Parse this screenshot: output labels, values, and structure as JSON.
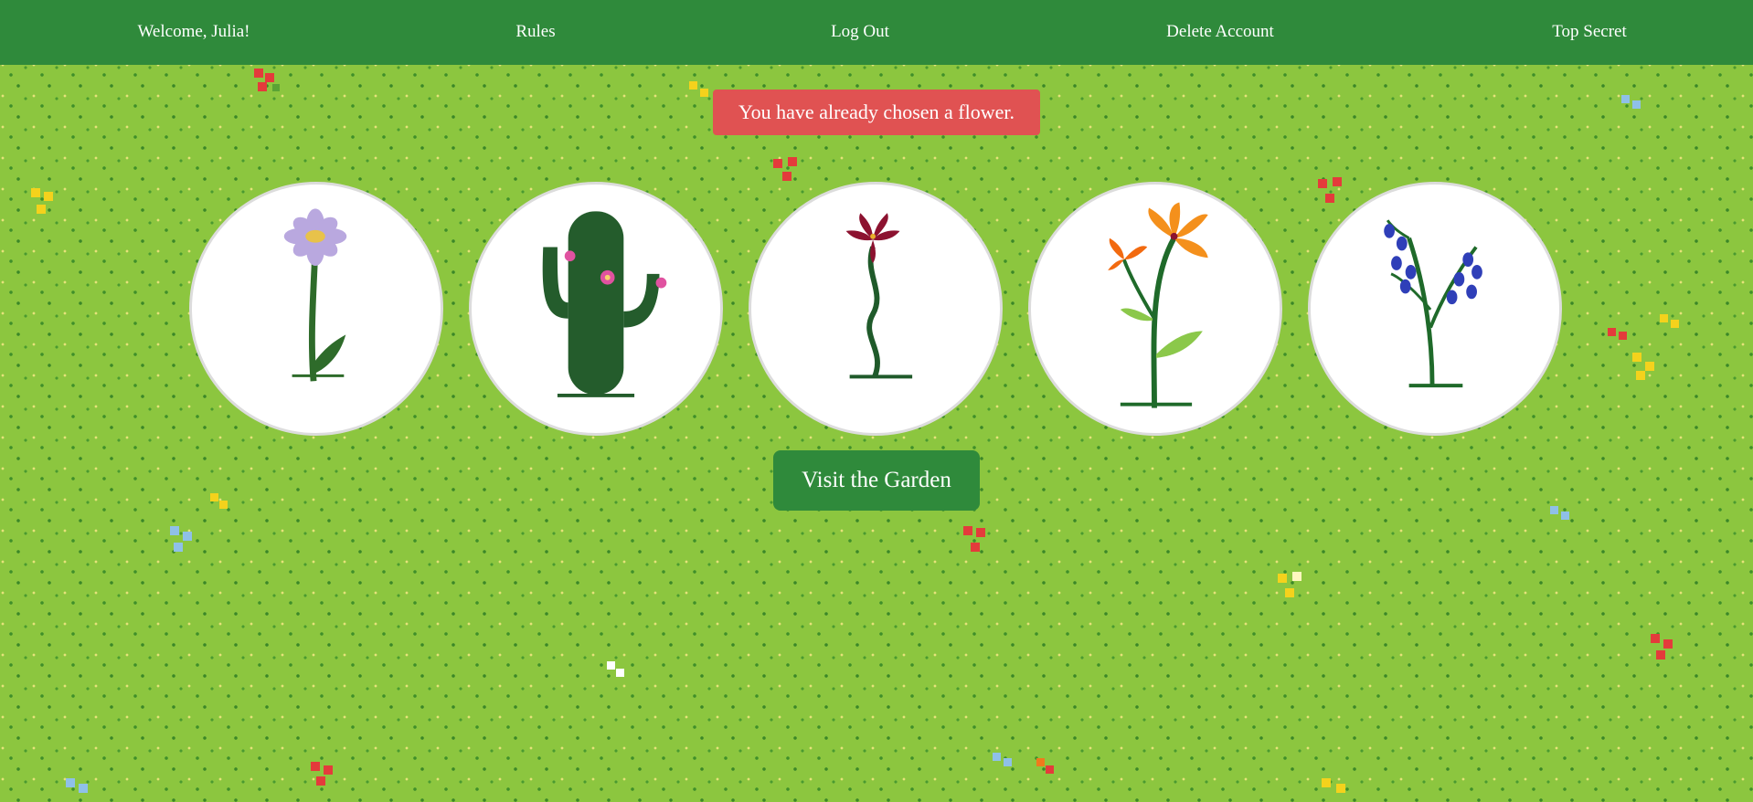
{
  "nav": {
    "welcome": "Welcome, Julia!",
    "rules": "Rules",
    "logout": "Log Out",
    "delete_account": "Delete Account",
    "top_secret": "Top Secret"
  },
  "alert": {
    "message": "You have already chosen a flower."
  },
  "flowers": [
    {
      "icon": "daisy-icon"
    },
    {
      "icon": "cactus-icon"
    },
    {
      "icon": "lily-icon"
    },
    {
      "icon": "tiger-lily-icon"
    },
    {
      "icon": "bluebell-icon"
    }
  ],
  "garden_button": {
    "label": "Visit the Garden"
  },
  "colors": {
    "nav_background": "#2f8a3b",
    "grass": "#8cc63f",
    "alert": "#e05252",
    "button": "#2f8a3b"
  }
}
